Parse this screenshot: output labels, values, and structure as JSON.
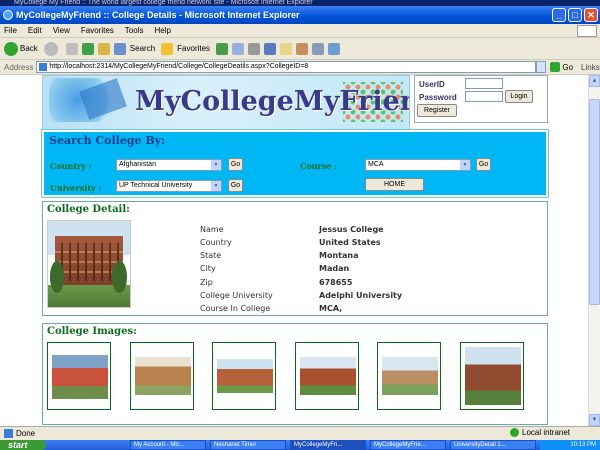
{
  "window": {
    "ghost_title": "MyCollege My Friend :: The world largest college friend network site - Microsoft Internet Explorer",
    "title": "MyCollegeMyFriend :: College Details - Microsoft Internet Explorer",
    "minimize": "_",
    "maximize": "□",
    "close": "✕"
  },
  "menu": [
    "File",
    "Edit",
    "View",
    "Favorites",
    "Tools",
    "Help"
  ],
  "toolbar": {
    "back": "Back",
    "search": "Search",
    "favorites": "Favorites"
  },
  "address": {
    "label": "Address",
    "url": "http://localhost:2314/MyCollegeMyFriend/College/CollegeDeatils.aspx?CollegeID=8",
    "go": "Go",
    "links": "Links"
  },
  "header": {
    "logo_text": "MyCollegeMyFriend",
    "userid_label": "UserID",
    "password_label": "Password",
    "login_button": "Login",
    "register_button": "Register"
  },
  "search": {
    "title": "Search College By:",
    "country_label": "Country :",
    "country_value": "Afghanistan",
    "course_label": "Course :",
    "course_value": "MCA",
    "university_label": "University :",
    "university_value": "UP Technical University",
    "go": "Go",
    "home_button": "HOME"
  },
  "detail": {
    "title": "College Detail:",
    "rows": [
      {
        "label": "Name",
        "value": "Jessus College"
      },
      {
        "label": "Country",
        "value": "United States"
      },
      {
        "label": "State",
        "value": "Montana"
      },
      {
        "label": "City",
        "value": "Madan"
      },
      {
        "label": "Zip",
        "value": "678655"
      },
      {
        "label": "College University",
        "value": "Adelphi University"
      },
      {
        "label": "Course In College",
        "value": "MCA,"
      }
    ]
  },
  "images": {
    "title": "College Images:"
  },
  "status": {
    "text": "Done",
    "zone": "Local intranet"
  },
  "taskbar": {
    "start": "start",
    "tasks": [
      "My Account - Mic...",
      "Neshanet Timer",
      "MyCollegeMyFri...",
      "MyCollegeMyFrie...",
      "UniversityDetail 1..."
    ],
    "clock": "10:13 PM"
  }
}
